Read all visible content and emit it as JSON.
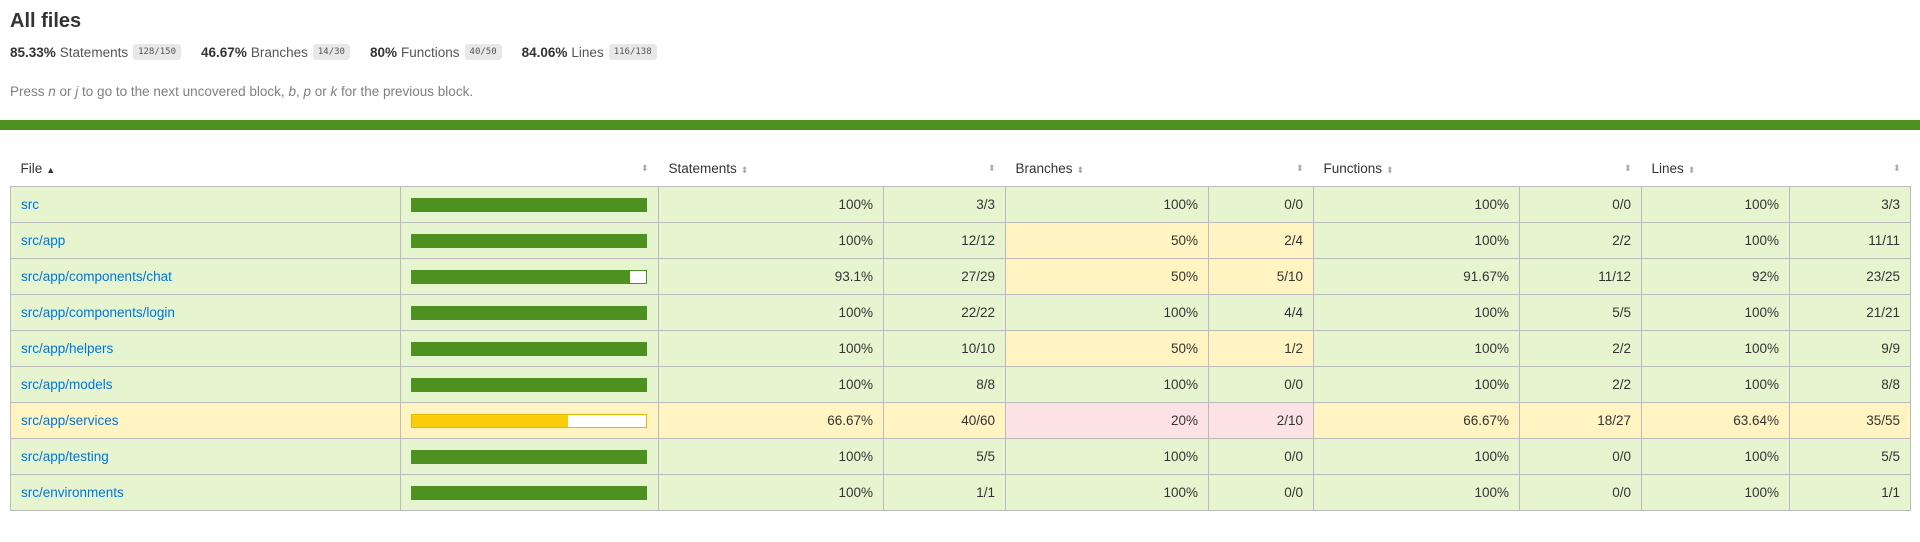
{
  "header": {
    "title": "All files",
    "summary": [
      {
        "pct": "85.33%",
        "label": "Statements",
        "fraction": "128/150"
      },
      {
        "pct": "46.67%",
        "label": "Branches",
        "fraction": "14/30"
      },
      {
        "pct": "80%",
        "label": "Functions",
        "fraction": "40/50"
      },
      {
        "pct": "84.06%",
        "label": "Lines",
        "fraction": "116/138"
      }
    ],
    "help": {
      "p1": "Press ",
      "k1": "n",
      "p2": " or ",
      "k2": "j",
      "p3": " to go to the next uncovered block, ",
      "k3": "b",
      "p4": ", ",
      "k4": "p",
      "p5": " or ",
      "k5": "k",
      "p6": " for the previous block."
    }
  },
  "colors": {
    "high": "#e6f5d0",
    "medium": "#fff4c2",
    "low": "#fce1e5",
    "bar_high": "#4d9221",
    "bar_medium": "#f9cd0b",
    "link": "#0074d9"
  },
  "table": {
    "headers": {
      "file": "File",
      "statements": "Statements",
      "branches": "Branches",
      "functions": "Functions",
      "lines": "Lines"
    },
    "sort": {
      "column": "File",
      "direction": "ascending"
    },
    "rows": [
      {
        "file": "src",
        "level": "high",
        "coverage": 100,
        "statements_pct": "100%",
        "statements": "3/3",
        "branches_pct": "100%",
        "branches": "0/0",
        "b_level": "high",
        "functions_pct": "100%",
        "functions": "0/0",
        "f_level": "high",
        "lines_pct": "100%",
        "lines": "3/3",
        "l_level": "high"
      },
      {
        "file": "src/app",
        "level": "high",
        "coverage": 100,
        "statements_pct": "100%",
        "statements": "12/12",
        "branches_pct": "50%",
        "branches": "2/4",
        "b_level": "medium",
        "functions_pct": "100%",
        "functions": "2/2",
        "f_level": "high",
        "lines_pct": "100%",
        "lines": "11/11",
        "l_level": "high"
      },
      {
        "file": "src/app/components/chat",
        "level": "high",
        "coverage": 93.1,
        "statements_pct": "93.1%",
        "statements": "27/29",
        "branches_pct": "50%",
        "branches": "5/10",
        "b_level": "medium",
        "functions_pct": "91.67%",
        "functions": "11/12",
        "f_level": "high",
        "lines_pct": "92%",
        "lines": "23/25",
        "l_level": "high"
      },
      {
        "file": "src/app/components/login",
        "level": "high",
        "coverage": 100,
        "statements_pct": "100%",
        "statements": "22/22",
        "branches_pct": "100%",
        "branches": "4/4",
        "b_level": "high",
        "functions_pct": "100%",
        "functions": "5/5",
        "f_level": "high",
        "lines_pct": "100%",
        "lines": "21/21",
        "l_level": "high"
      },
      {
        "file": "src/app/helpers",
        "level": "high",
        "coverage": 100,
        "statements_pct": "100%",
        "statements": "10/10",
        "branches_pct": "50%",
        "branches": "1/2",
        "b_level": "medium",
        "functions_pct": "100%",
        "functions": "2/2",
        "f_level": "high",
        "lines_pct": "100%",
        "lines": "9/9",
        "l_level": "high"
      },
      {
        "file": "src/app/models",
        "level": "high",
        "coverage": 100,
        "statements_pct": "100%",
        "statements": "8/8",
        "branches_pct": "100%",
        "branches": "0/0",
        "b_level": "high",
        "functions_pct": "100%",
        "functions": "2/2",
        "f_level": "high",
        "lines_pct": "100%",
        "lines": "8/8",
        "l_level": "high"
      },
      {
        "file": "src/app/services",
        "level": "medium",
        "coverage": 66.67,
        "statements_pct": "66.67%",
        "statements": "40/60",
        "branches_pct": "20%",
        "branches": "2/10",
        "b_level": "low",
        "functions_pct": "66.67%",
        "functions": "18/27",
        "f_level": "medium",
        "lines_pct": "63.64%",
        "lines": "35/55",
        "l_level": "medium"
      },
      {
        "file": "src/app/testing",
        "level": "high",
        "coverage": 100,
        "statements_pct": "100%",
        "statements": "5/5",
        "branches_pct": "100%",
        "branches": "0/0",
        "b_level": "high",
        "functions_pct": "100%",
        "functions": "0/0",
        "f_level": "high",
        "lines_pct": "100%",
        "lines": "5/5",
        "l_level": "high"
      },
      {
        "file": "src/environments",
        "level": "high",
        "coverage": 100,
        "statements_pct": "100%",
        "statements": "1/1",
        "branches_pct": "100%",
        "branches": "0/0",
        "b_level": "high",
        "functions_pct": "100%",
        "functions": "0/0",
        "f_level": "high",
        "lines_pct": "100%",
        "lines": "1/1",
        "l_level": "high"
      }
    ]
  }
}
